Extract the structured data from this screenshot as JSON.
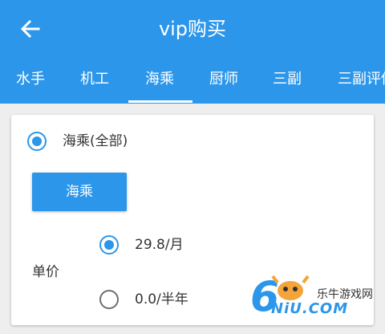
{
  "appbar": {
    "title": "vip购买",
    "back_icon": "arrow-left-icon",
    "color": "#2c96ea"
  },
  "tabs": [
    {
      "label": "水手",
      "selected": false
    },
    {
      "label": "机工",
      "selected": false
    },
    {
      "label": "海乘",
      "selected": true
    },
    {
      "label": "厨师",
      "selected": false
    },
    {
      "label": "三副",
      "selected": false
    },
    {
      "label": "三副评估",
      "selected": false
    }
  ],
  "card": {
    "category": {
      "label": "海乘(全部)",
      "selected": true
    },
    "action_button_label": "海乘",
    "price_label": "单价",
    "price_options": [
      {
        "label": "29.8/月",
        "selected": true
      },
      {
        "label": "0.0/半年",
        "selected": false
      }
    ]
  },
  "watermark": {
    "chinese": "乐牛游戏网",
    "latin": "NiU.COM",
    "digit": "6"
  }
}
